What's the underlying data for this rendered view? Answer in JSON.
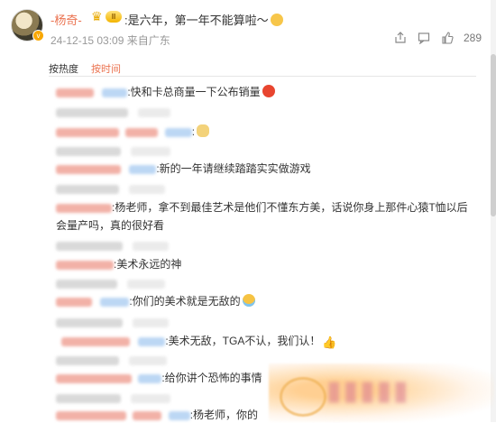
{
  "header": {
    "author": "-杨奇-",
    "badge_level": "II",
    "comment_text": ":是六年，第一年不能算啦～",
    "meta": "24-12-15 03:09 来自广东",
    "like_count": "289",
    "vip_mark": "v"
  },
  "sort": {
    "hot_label": "按热度",
    "time_label": "按时间"
  },
  "replies": [
    {
      "text": ":快和卡总商量一下公布销量",
      "emoji": "angry-emoji"
    },
    {
      "text": ":",
      "emoji": "dog-emoji"
    },
    {
      "text": ":新的一年请继续踏踏实实做游戏",
      "emoji": ""
    },
    {
      "text": ":杨老师，拿不到最佳艺术是他们不懂东方美，话说你身上那件心猿T恤以后会量产吗，真的很好看",
      "emoji": ""
    },
    {
      "text": ":美术永远的神",
      "emoji": ""
    },
    {
      "text": ":你们的美术就是无敌的",
      "emoji": "cry-emoji"
    },
    {
      "text": ":美术无敌，TGA不认，我们认！",
      "emoji": "thumbs-up-emoji"
    },
    {
      "text": ":给你讲个恐怖的事情",
      "emoji": ""
    },
    {
      "text": ":杨老师，你的",
      "emoji": ""
    }
  ],
  "colors": {
    "accent": "#eb7350",
    "meta_gray": "#999999"
  },
  "icons": [
    "share-icon",
    "comment-icon",
    "like-icon",
    "crown-icon"
  ]
}
